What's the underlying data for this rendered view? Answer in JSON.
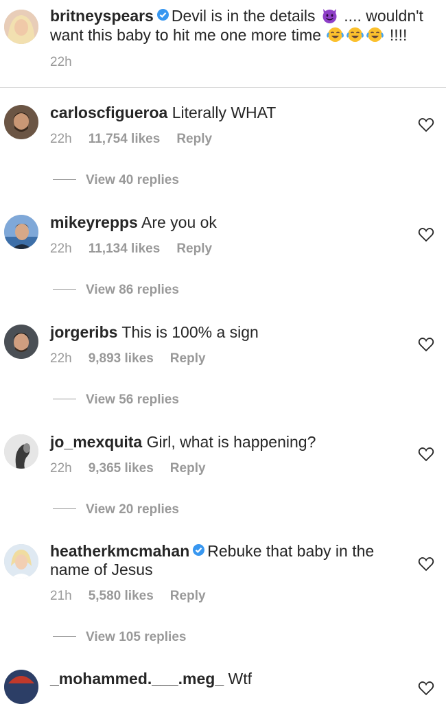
{
  "caption": {
    "username": "britneyspears",
    "text_part1": "Devil is in the details",
    "text_part2": ".... wouldn't want this baby to hit me one more time",
    "text_part3": "!!!!",
    "time": "22h"
  },
  "comments": [
    {
      "username": "carloscfigueroa",
      "text": "Literally WHAT",
      "time": "22h",
      "likes": "11,754 likes",
      "reply": "Reply",
      "view_replies": "View 40 replies"
    },
    {
      "username": "mikeyrepps",
      "text": "Are you ok",
      "time": "22h",
      "likes": "11,134 likes",
      "reply": "Reply",
      "view_replies": "View 86 replies"
    },
    {
      "username": "jorgeribs",
      "text": "This is 100% a sign",
      "time": "22h",
      "likes": "9,893 likes",
      "reply": "Reply",
      "view_replies": "View 56 replies"
    },
    {
      "username": "jo_mexquita",
      "text": "Girl, what is happening?",
      "time": "22h",
      "likes": "9,365 likes",
      "reply": "Reply",
      "view_replies": "View 20 replies"
    },
    {
      "username": "heatherkmcmahan",
      "text": "Rebuke that baby in the name of Jesus",
      "time": "21h",
      "likes": "5,580 likes",
      "reply": "Reply",
      "view_replies": "View 105 replies"
    },
    {
      "username": "_mohammed.___.meg_",
      "text": "Wtf"
    }
  ],
  "colors": {
    "verified": "#3897f0",
    "muted": "#999999",
    "text": "#262626"
  }
}
